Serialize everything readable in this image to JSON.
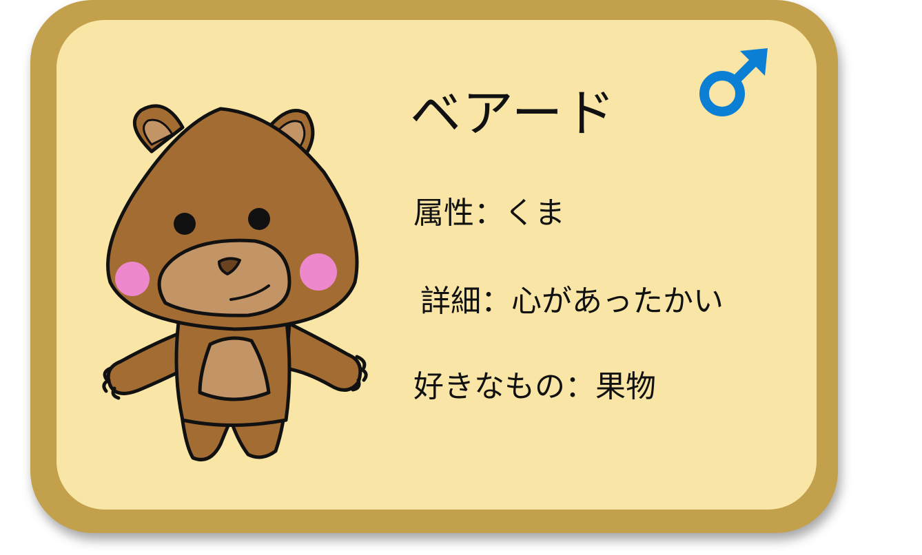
{
  "card": {
    "name": "ベアード",
    "gender_icon": "male-symbol-icon",
    "attribute": "属性：くま",
    "detail": "詳細：心があったかい",
    "likes": "好きなもの：果物"
  },
  "colors": {
    "frame": "#c3a04c",
    "background": "#f9e6a6",
    "bear_fur": "#a36c33",
    "bear_muzzle": "#c39466",
    "cheeks": "#ee88cc",
    "male_symbol": "#0b7fd4"
  }
}
